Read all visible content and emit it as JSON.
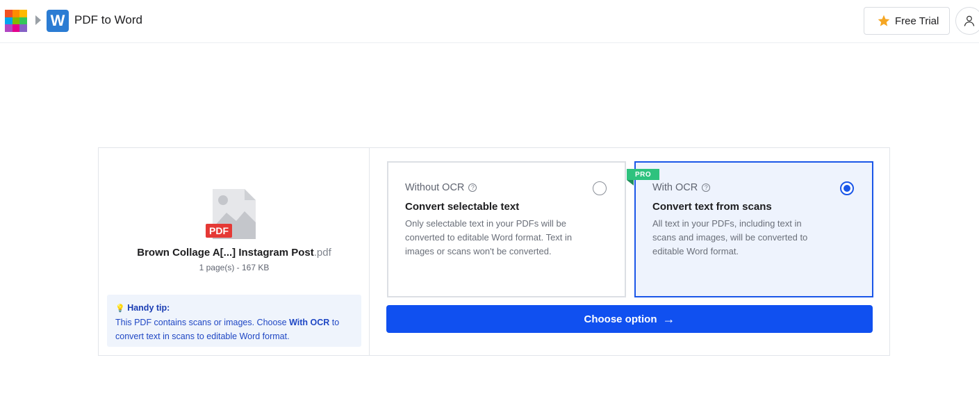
{
  "header": {
    "app_title": "PDF to Word",
    "app_logo_letter": "W",
    "free_trial_label": "Free Trial",
    "grid_colors": [
      "#f25022",
      "#ff8c00",
      "#ffb900",
      "#00a4ef",
      "#7fba00",
      "#34c759",
      "#b146c2",
      "#e3008c",
      "#8661c5"
    ]
  },
  "file": {
    "name_base": "Brown Collage A[...] Instagram Post",
    "name_ext": ".pdf",
    "meta": "1 page(s) - 167 KB",
    "badge": "PDF"
  },
  "tip": {
    "icon": "💡",
    "title": "Handy tip:",
    "text_before": "This PDF contains scans or images. Choose ",
    "text_bold": "With OCR",
    "text_after": " to convert text in scans to editable Word format."
  },
  "options": {
    "without": {
      "label": "Without OCR",
      "title": "Convert selectable text",
      "description": "Only selectable text in your PDFs will be converted to editable Word format. Text in images or scans won't be converted.",
      "selected": false
    },
    "with": {
      "label": "With OCR",
      "title": "Convert text from scans",
      "description": "All text in your PDFs, including text in scans and images, will be converted to editable Word format.",
      "badge": "PRO",
      "selected": true
    }
  },
  "actions": {
    "choose_label": "Choose option",
    "choose_icon": "→"
  },
  "colors": {
    "accent": "#1050f0",
    "pro_badge": "#2ec27e",
    "pdf_badge": "#e53935",
    "word_blue": "#2b7cd3"
  }
}
